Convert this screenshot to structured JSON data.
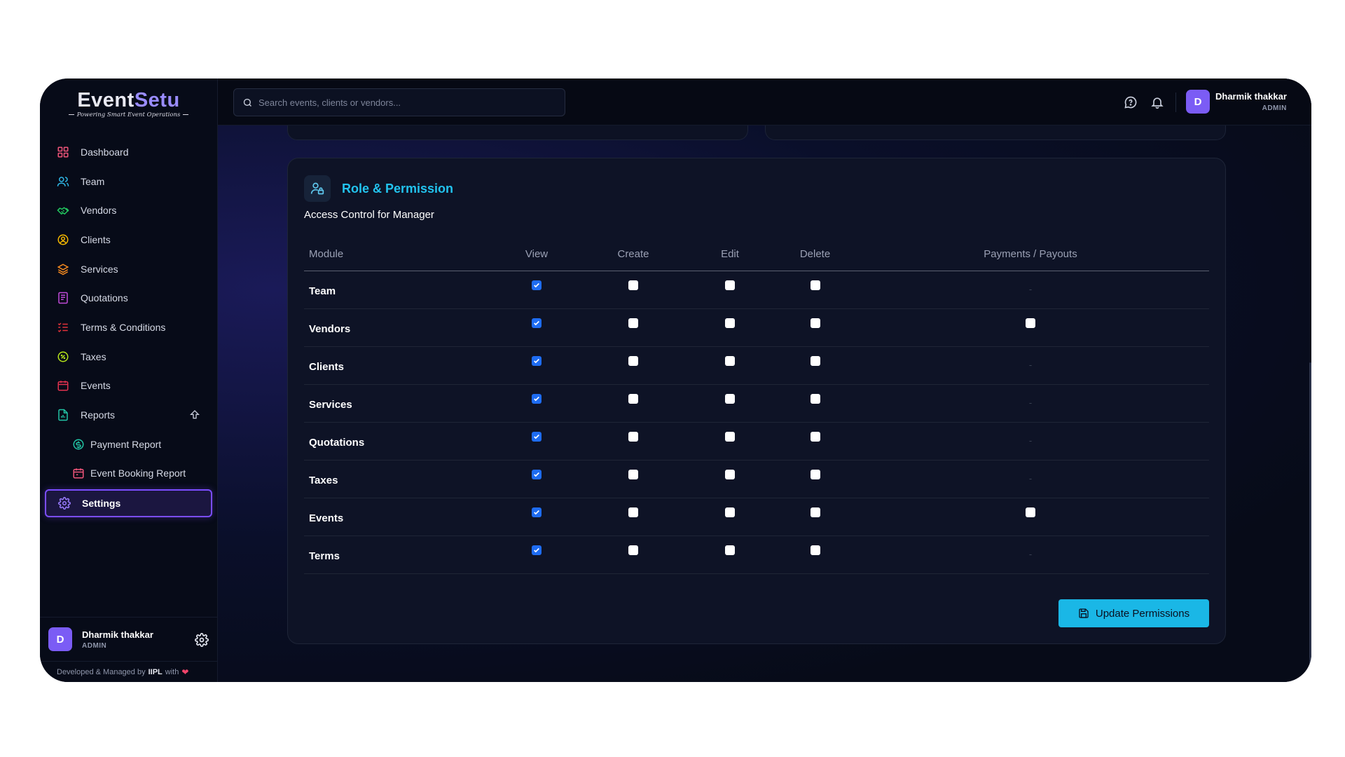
{
  "brand": {
    "name_part1": "Event",
    "name_part2": "Setu",
    "tagline": "Powering Smart Event Operations"
  },
  "sidebar": {
    "items": [
      {
        "label": "Dashboard",
        "icon": "dashboard-grid-icon",
        "color": "#f0557a"
      },
      {
        "label": "Team",
        "icon": "users-icon",
        "color": "#2fb8e8"
      },
      {
        "label": "Vendors",
        "icon": "handshake-icon",
        "color": "#22c55e"
      },
      {
        "label": "Clients",
        "icon": "user-circle-icon",
        "color": "#f5b800"
      },
      {
        "label": "Services",
        "icon": "layers-icon",
        "color": "#f58a1f"
      },
      {
        "label": "Quotations",
        "icon": "document-list-icon",
        "color": "#c04bd8"
      },
      {
        "label": "Terms & Conditions",
        "icon": "checklist-icon",
        "color": "#e2323a"
      },
      {
        "label": "Taxes",
        "icon": "percent-badge-icon",
        "color": "#b5e51a"
      },
      {
        "label": "Events",
        "icon": "calendar-icon",
        "color": "#e2324f"
      },
      {
        "label": "Reports",
        "icon": "report-file-icon",
        "color": "#22c5a5"
      }
    ],
    "sub_items": [
      {
        "label": "Payment Report",
        "icon": "coin-icon",
        "color": "#22c5a5"
      },
      {
        "label": "Event Booking Report",
        "icon": "calendar-booking-icon",
        "color": "#f0557a"
      }
    ],
    "active": {
      "label": "Settings",
      "icon": "gear-icon",
      "color": "#9a7cff"
    },
    "user": {
      "initial": "D",
      "name": "Dharmik thakkar",
      "role": "ADMIN"
    },
    "footer": {
      "prefix": "Developed & Managed by",
      "company": "IIPL",
      "suffix": "with"
    }
  },
  "topbar": {
    "search_placeholder": "Search events, clients or vendors...",
    "user": {
      "initial": "D",
      "name": "Dharmik thakkar",
      "role": "ADMIN"
    }
  },
  "card": {
    "title": "Role & Permission",
    "subtitle": "Access Control for Manager",
    "columns": [
      "Module",
      "View",
      "Create",
      "Edit",
      "Delete",
      "Payments / Payouts"
    ],
    "rows": [
      {
        "module": "Team",
        "view": true,
        "create": false,
        "edit": false,
        "delete": false,
        "payments": null
      },
      {
        "module": "Vendors",
        "view": true,
        "create": false,
        "edit": false,
        "delete": false,
        "payments": false
      },
      {
        "module": "Clients",
        "view": true,
        "create": false,
        "edit": false,
        "delete": false,
        "payments": null
      },
      {
        "module": "Services",
        "view": true,
        "create": false,
        "edit": false,
        "delete": false,
        "payments": null
      },
      {
        "module": "Quotations",
        "view": true,
        "create": false,
        "edit": false,
        "delete": false,
        "payments": null
      },
      {
        "module": "Taxes",
        "view": true,
        "create": false,
        "edit": false,
        "delete": false,
        "payments": null
      },
      {
        "module": "Events",
        "view": true,
        "create": false,
        "edit": false,
        "delete": false,
        "payments": false
      },
      {
        "module": "Terms",
        "view": true,
        "create": false,
        "edit": false,
        "delete": false,
        "payments": null
      }
    ],
    "na_text": "-",
    "update_button": "Update Permissions"
  },
  "colors": {
    "accent": "#1ab7e6",
    "active_border": "#7b4dff",
    "checkbox_on": "#1e6cf2",
    "avatar": "#7b5cf5"
  }
}
